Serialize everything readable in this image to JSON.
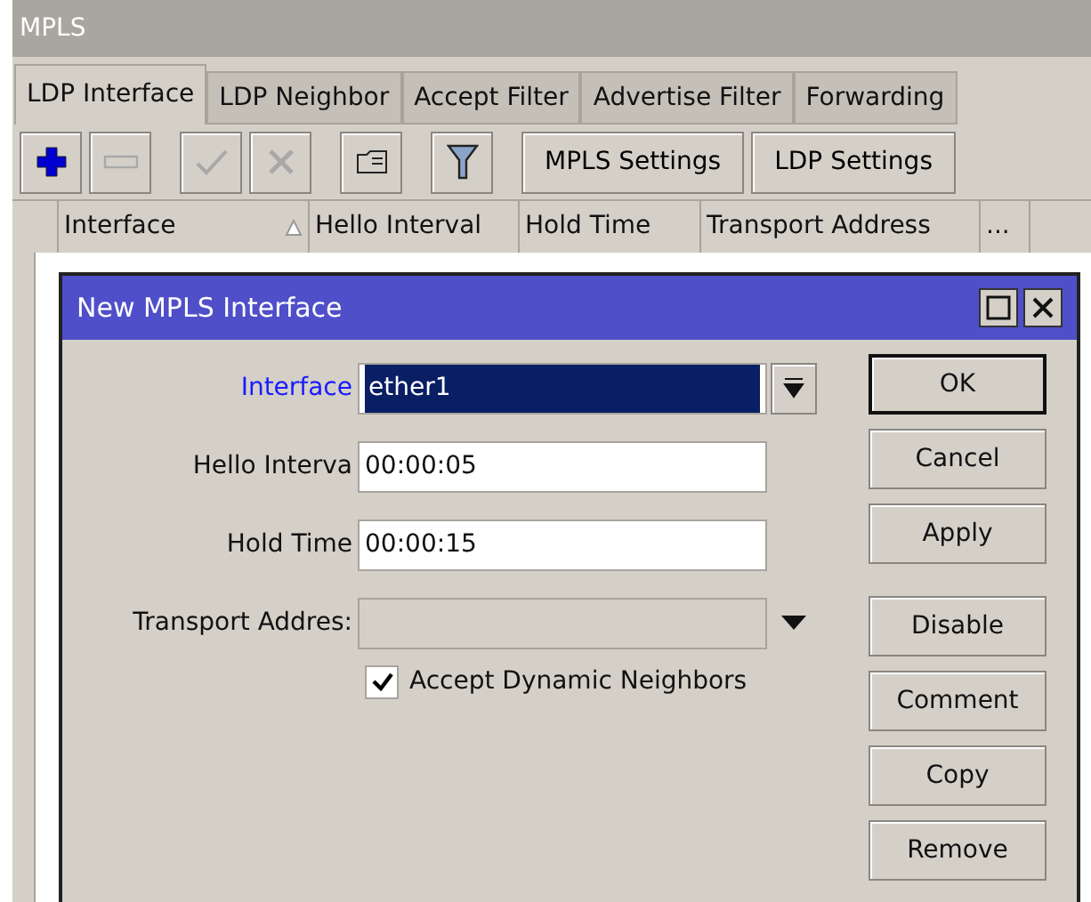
{
  "window": {
    "title": "MPLS"
  },
  "tabs": [
    {
      "label": "LDP Interface",
      "selected": true
    },
    {
      "label": "LDP Neighbor",
      "selected": false
    },
    {
      "label": "Accept Filter",
      "selected": false
    },
    {
      "label": "Advertise Filter",
      "selected": false
    },
    {
      "label": "Forwarding",
      "selected": false
    }
  ],
  "toolbar": {
    "icon_buttons": [
      {
        "kind": "add",
        "disabled": false
      },
      {
        "kind": "remove",
        "disabled": true
      },
      {
        "kind": "enable",
        "disabled": true
      },
      {
        "kind": "disable",
        "disabled": true
      },
      {
        "kind": "comment",
        "disabled": false
      },
      {
        "kind": "filter",
        "disabled": false
      }
    ],
    "buttons": [
      "MPLS Settings",
      "LDP Settings"
    ]
  },
  "table": {
    "columns": [
      "Interface",
      "Hello Interval",
      "Hold Time",
      "Transport Address",
      "..."
    ]
  },
  "dialog": {
    "title": "New MPLS Interface",
    "fields": [
      {
        "label": "Interface",
        "kind": "dropdown",
        "value": "ether1",
        "focused": true,
        "disabled": false
      },
      {
        "label": "Hello Interva",
        "kind": "text",
        "value": "00:00:05",
        "focused": false,
        "disabled": false
      },
      {
        "label": "Hold Time",
        "kind": "text",
        "value": "00:00:15",
        "focused": false,
        "disabled": false
      },
      {
        "label": "Transport Addres:",
        "kind": "dropdown",
        "focused": false,
        "disabled": true
      }
    ],
    "checkbox": {
      "label": "Accept Dynamic Neighbors",
      "checked": true
    },
    "buttons": [
      {
        "label": "OK",
        "default": true
      },
      {
        "label": "Cancel",
        "default": false
      },
      {
        "label": "Apply",
        "default": false
      },
      {
        "label": "Disable",
        "default": false
      },
      {
        "label": "Comment",
        "default": false
      },
      {
        "label": "Copy",
        "default": false
      },
      {
        "label": "Remove",
        "default": false
      }
    ]
  }
}
